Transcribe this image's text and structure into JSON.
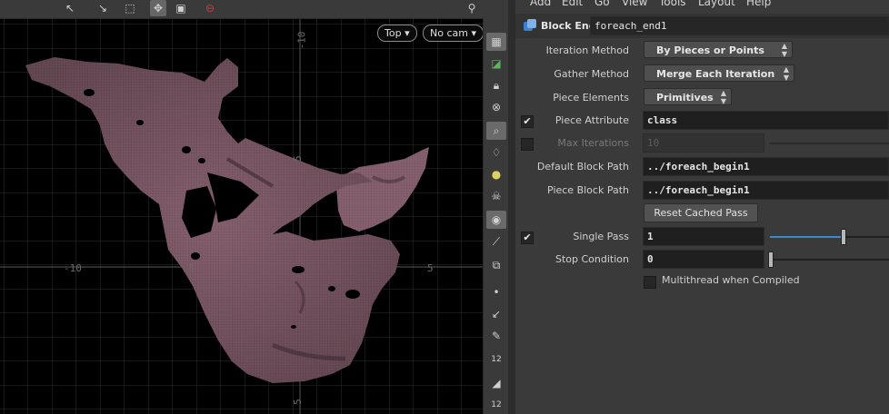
{
  "viewport": {
    "toolbar_icons": [
      "select-transform-icon",
      "pose-icon",
      "handle-icon",
      "snap-icon",
      "display-options-icon",
      "record-icon",
      "help-icon"
    ],
    "view_dropdown": "Top",
    "camera_dropdown": "No cam",
    "tick_labels": {
      "left": "-10",
      "x_mid": "5",
      "x_right": "5",
      "y_top": "-10",
      "y_mid": "5",
      "y_bottom": "5"
    }
  },
  "toolstrip": {
    "icons": [
      "view-layout-icon",
      "wireframe-icon",
      "lock-icon",
      "camera-icon",
      "zoom-icon",
      "light-icon",
      "lightbulb-icon",
      "skull-icon",
      "sphere-icon",
      "normals-icon",
      "uv-icon",
      "point-icon",
      "curve-icon",
      "brush-icon",
      "number-icon",
      "measure-icon",
      "count-icon"
    ],
    "number_label": "12"
  },
  "menubar": [
    "Add",
    "Edit",
    "Go",
    "View",
    "Tools",
    "Layout",
    "Help"
  ],
  "node": {
    "type_label": "Block End",
    "name": "foreach_end1"
  },
  "params": {
    "iteration_method": {
      "label": "Iteration Method",
      "value": "By Pieces or Points"
    },
    "gather_method": {
      "label": "Gather Method",
      "value": "Merge Each Iteration"
    },
    "piece_elements": {
      "label": "Piece Elements",
      "value": "Primitives"
    },
    "piece_attribute": {
      "label": "Piece Attribute",
      "value": "class",
      "checked": true
    },
    "max_iterations": {
      "label": "Max Iterations",
      "value": "10",
      "checked": false
    },
    "default_block_path": {
      "label": "Default Block Path",
      "value": "../foreach_begin1"
    },
    "piece_block_path": {
      "label": "Piece Block Path",
      "value": "../foreach_begin1"
    },
    "reset_button": "Reset Cached Pass",
    "single_pass": {
      "label": "Single Pass",
      "value": "1",
      "checked": true,
      "slider_fraction": 0.62
    },
    "stop_condition": {
      "label": "Stop Condition",
      "value": "0",
      "slider_fraction": 0.0
    },
    "multithread": {
      "label": "Multithread when Compiled",
      "checked": false
    }
  },
  "colors": {
    "mesh": "#8a5f70",
    "slider_fill": "#3a8ad0",
    "viewport_bg": "#000000"
  }
}
